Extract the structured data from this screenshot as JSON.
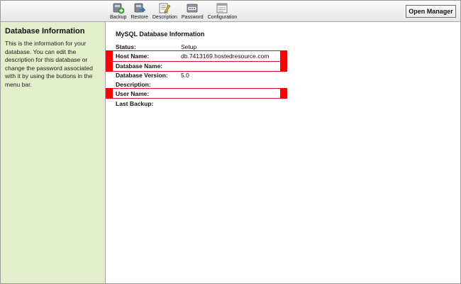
{
  "toolbar": {
    "items": [
      {
        "label": "Backup",
        "icon": "backup-icon"
      },
      {
        "label": "Restore",
        "icon": "restore-icon"
      },
      {
        "label": "Description",
        "icon": "description-icon"
      },
      {
        "label": "Password",
        "icon": "password-icon"
      },
      {
        "label": "Configuration",
        "icon": "configuration-icon"
      }
    ],
    "open_manager_label": "Open Manager"
  },
  "sidebar": {
    "title": "Database Information",
    "text": "This is the information for your database. You can edit the description for this database or change the password associated with it by using the buttons in the menu bar."
  },
  "main": {
    "title": "MySQL Database Information",
    "fields": [
      {
        "label": "Status:",
        "value": "Setup"
      },
      {
        "label": "Host Name:",
        "value": "db.7413169.hostedresource.com"
      },
      {
        "label": "Database Name:",
        "value": ""
      },
      {
        "label": "Database Version:",
        "value": "5.0"
      },
      {
        "label": "Description:",
        "value": ""
      },
      {
        "label": "User Name:",
        "value": ""
      },
      {
        "label": "Last Backup:",
        "value": ""
      }
    ]
  },
  "colors": {
    "sidebar_bg": "#e3efcb",
    "highlight_red": "#ff0000",
    "toolbar_bg": "#eeeeee"
  }
}
